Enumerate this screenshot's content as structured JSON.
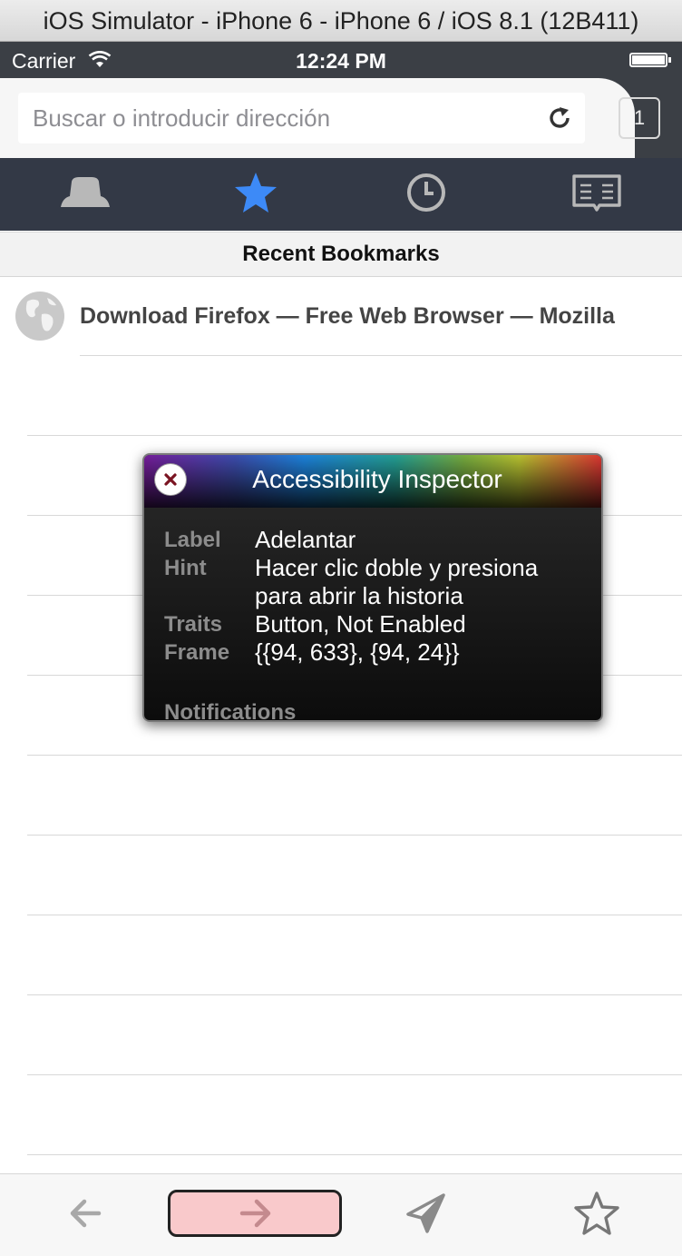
{
  "simulator": {
    "title": "iOS Simulator - iPhone 6 - iPhone 6 / iOS 8.1 (12B411)"
  },
  "statusbar": {
    "carrier": "Carrier",
    "time": "12:24 PM"
  },
  "urlbar": {
    "placeholder": "Buscar o introducir dirección",
    "tab_count": "1"
  },
  "panels": [
    {
      "name": "top-sites",
      "icon": "top-sites-icon"
    },
    {
      "name": "bookmarks",
      "icon": "star-icon",
      "active": true
    },
    {
      "name": "history",
      "icon": "clock-icon"
    },
    {
      "name": "reading-list",
      "icon": "book-icon"
    }
  ],
  "bookmarks": {
    "header": "Recent Bookmarks",
    "items": [
      {
        "title": "Download Firefox — Free Web Browser — Mozilla",
        "icon": "globe-icon"
      }
    ]
  },
  "inspector": {
    "title": "Accessibility Inspector",
    "label_key": "Label",
    "label_value": "Adelantar",
    "hint_key": "Hint",
    "hint_value": "Hacer clic doble y presiona para abrir la historia",
    "traits_key": "Traits",
    "traits_value": "Button, Not Enabled",
    "frame_key": "Frame",
    "frame_value": "{{94, 633}, {94, 24}}",
    "notifications": "Notifications"
  },
  "colors": {
    "active_panel": "#3d8af7",
    "inactive_icon": "#b8b8b8",
    "highlight": "#f9c9cb"
  },
  "toolbar": {
    "items": [
      "back-arrow-icon",
      "forward-arrow-icon",
      "share-icon",
      "star-outline-icon"
    ]
  }
}
